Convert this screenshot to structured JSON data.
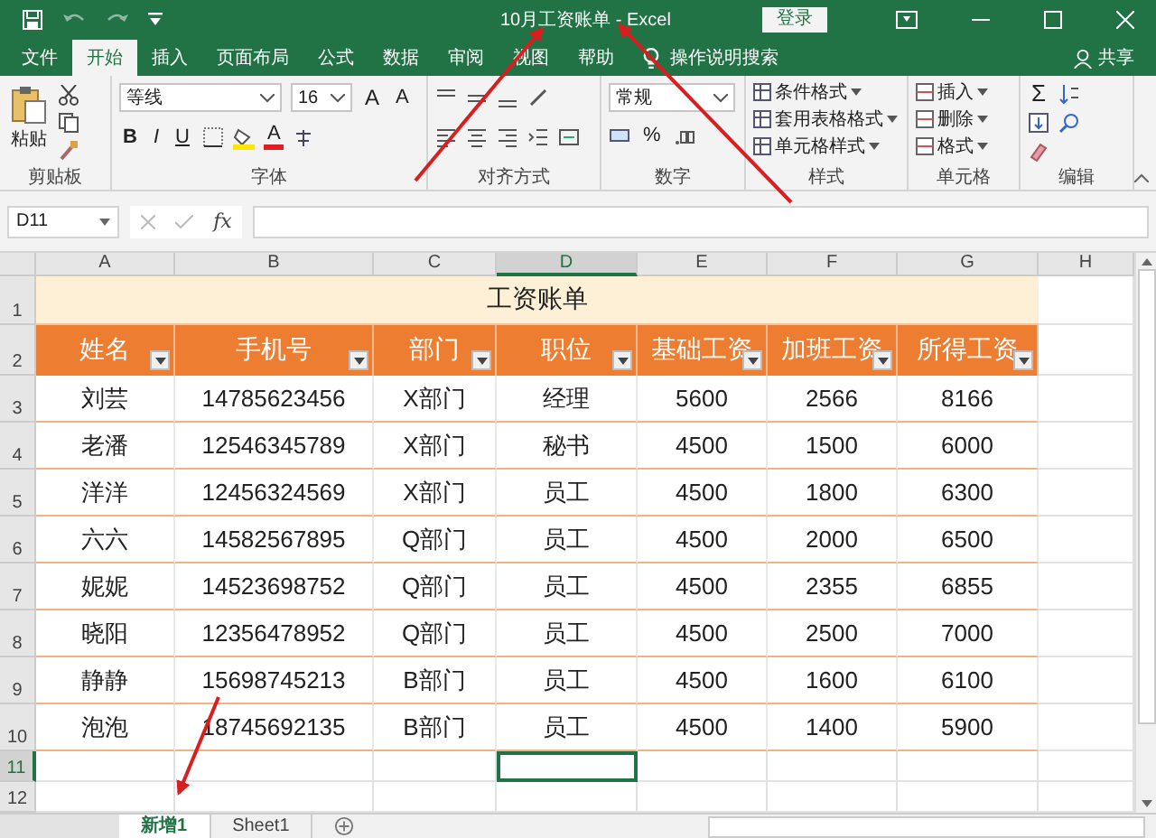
{
  "title_bar": {
    "title": "10月工资账单 - Excel",
    "login_button": "登录"
  },
  "menu_tabs": [
    {
      "label": "文件",
      "selected": false
    },
    {
      "label": "开始",
      "selected": true
    },
    {
      "label": "插入",
      "selected": false
    },
    {
      "label": "页面布局",
      "selected": false
    },
    {
      "label": "公式",
      "selected": false
    },
    {
      "label": "数据",
      "selected": false
    },
    {
      "label": "审阅",
      "selected": false
    },
    {
      "label": "视图",
      "selected": false
    },
    {
      "label": "帮助",
      "selected": false
    }
  ],
  "tell_me": "操作说明搜索",
  "share": "共享",
  "ribbon": {
    "clipboard": {
      "paste": "粘贴",
      "label": "剪贴板"
    },
    "font": {
      "name": "等线",
      "size": "16",
      "style_buttons": [
        "B",
        "I",
        "U"
      ],
      "grow": "A",
      "shrink": "A",
      "color_button": "A",
      "label": "字体"
    },
    "alignment": {
      "label": "对齐方式"
    },
    "number": {
      "format": "常规",
      "percent": "%",
      "label": "数字"
    },
    "styles": {
      "items": [
        "条件格式",
        "套用表格格式",
        "单元格样式"
      ],
      "label": "样式"
    },
    "cells": {
      "items": [
        "插入",
        "删除",
        "格式"
      ],
      "label": "单元格"
    },
    "editing": {
      "autosum": "Σ",
      "label": "编辑"
    }
  },
  "formula_bar": {
    "name_box": "D11",
    "function_label": "fx"
  },
  "grid": {
    "columns": [
      {
        "label": "A",
        "selected": false
      },
      {
        "label": "B",
        "selected": false
      },
      {
        "label": "C",
        "selected": false
      },
      {
        "label": "D",
        "selected": true
      },
      {
        "label": "E",
        "selected": false
      },
      {
        "label": "F",
        "selected": false
      },
      {
        "label": "G",
        "selected": false
      },
      {
        "label": "H",
        "selected": false
      }
    ],
    "title_row": {
      "number": "1",
      "text": "工资账单"
    },
    "header_row": {
      "number": "2",
      "cells": [
        "姓名",
        "手机号",
        "部门",
        "职位",
        "基础工资",
        "加班工资",
        "所得工资"
      ]
    },
    "data_rows": [
      {
        "number": "3",
        "cells": [
          "刘芸",
          "14785623456",
          "X部门",
          "经理",
          "5600",
          "2566",
          "8166"
        ]
      },
      {
        "number": "4",
        "cells": [
          "老潘",
          "12546345789",
          "X部门",
          "秘书",
          "4500",
          "1500",
          "6000"
        ]
      },
      {
        "number": "5",
        "cells": [
          "洋洋",
          "12456324569",
          "X部门",
          "员工",
          "4500",
          "1800",
          "6300"
        ]
      },
      {
        "number": "6",
        "cells": [
          "六六",
          "14582567895",
          "Q部门",
          "员工",
          "4500",
          "2000",
          "6500"
        ]
      },
      {
        "number": "7",
        "cells": [
          "妮妮",
          "14523698752",
          "Q部门",
          "员工",
          "4500",
          "2355",
          "6855"
        ]
      },
      {
        "number": "8",
        "cells": [
          "晓阳",
          "12356478952",
          "Q部门",
          "员工",
          "4500",
          "2500",
          "7000"
        ]
      },
      {
        "number": "9",
        "cells": [
          "静静",
          "15698745213",
          "B部门",
          "员工",
          "4500",
          "1600",
          "6100"
        ]
      },
      {
        "number": "10",
        "cells": [
          "泡泡",
          "18745692135",
          "B部门",
          "员工",
          "4500",
          "1400",
          "5900"
        ]
      }
    ],
    "empty_rows": [
      {
        "number": "11",
        "selected": true
      },
      {
        "number": "12",
        "selected": false
      }
    ]
  },
  "sheet_tabs": [
    {
      "label": "新增1",
      "selected": true
    },
    {
      "label": "Sheet1",
      "selected": false
    }
  ]
}
